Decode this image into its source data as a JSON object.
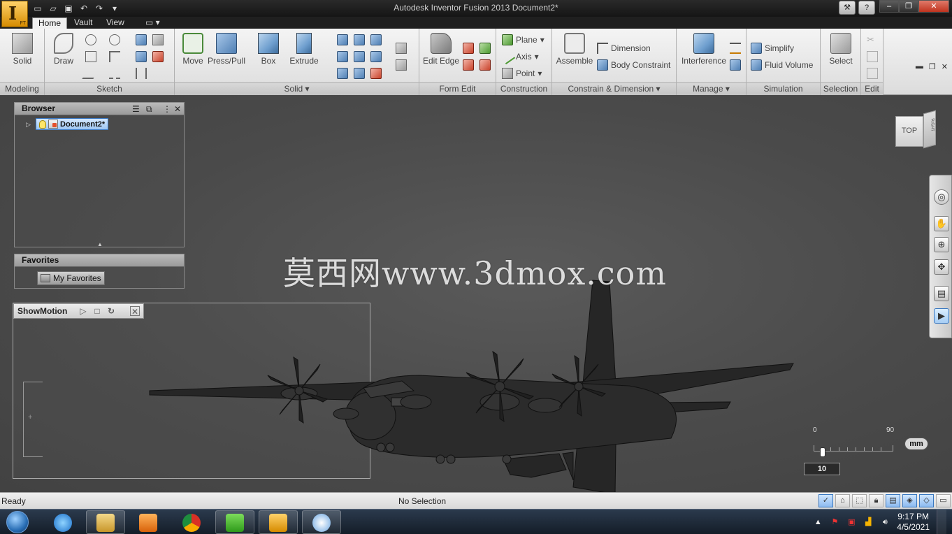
{
  "window": {
    "title": "Autodesk Inventor Fusion 2013    Document2*",
    "logo_letter": "I",
    "logo_sub": "FT"
  },
  "tabs": [
    "Home",
    "Vault",
    "View"
  ],
  "ribbon": {
    "panels": {
      "modeling": "Modeling",
      "sketch": "Sketch",
      "solid": "Solid",
      "form_edit": "Form Edit",
      "construction": "Construction",
      "constrain": "Constrain & Dimension",
      "manage": "Manage",
      "simulation": "Simulation",
      "selection": "Selection",
      "edit": "Edit"
    },
    "buttons": {
      "solid": "Solid",
      "draw": "Draw",
      "move": "Move",
      "press_pull": "Press/Pull",
      "box": "Box",
      "extrude": "Extrude",
      "edit_edge": "Edit Edge",
      "plane": "Plane",
      "axis": "Axis",
      "point": "Point",
      "assemble": "Assemble",
      "dimension": "Dimension",
      "body_constraint": "Body Constraint",
      "interference": "Interference",
      "simplify": "Simplify",
      "fluid_volume": "Fluid Volume",
      "select": "Select"
    }
  },
  "browser": {
    "title": "Browser",
    "document": "Document2*"
  },
  "favorites": {
    "title": "Favorites",
    "item": "My Favorites"
  },
  "showmotion": {
    "title": "ShowMotion"
  },
  "viewcube": {
    "top": "TOP",
    "right": "RIGHT"
  },
  "watermark": "莫西网www.3dmox.com",
  "ruler": {
    "start": "0",
    "end": "90",
    "unit": "mm",
    "value": "10"
  },
  "status": {
    "left": "Ready",
    "middle": "No Selection"
  },
  "taskbar": {
    "time": "9:17 PM",
    "date": "4/5/2021"
  }
}
